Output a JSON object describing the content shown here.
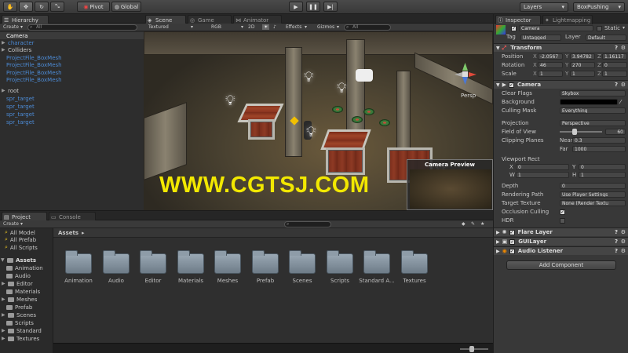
{
  "toolbar": {
    "pivot_label": "Pivot",
    "global_label": "Global",
    "layers_label": "Layers",
    "layout_label": "BoxPushing"
  },
  "hierarchy": {
    "tab_label": "Hierarchy",
    "create_label": "Create",
    "search_placeholder": "All",
    "items": [
      {
        "label": "Camera",
        "selected": true,
        "blue": false
      },
      {
        "label": "character",
        "blue": true,
        "arrow": true
      },
      {
        "label": "Colliders",
        "blue": false,
        "arrow": true
      },
      {
        "label": "ProjectFile_BoxMesh",
        "blue": true
      },
      {
        "label": "ProjectFile_BoxMesh",
        "blue": true
      },
      {
        "label": "ProjectFile_BoxMesh",
        "blue": true
      },
      {
        "label": "ProjectFile_BoxMesh",
        "blue": true
      },
      {
        "label": "root",
        "blue": false,
        "arrow": true
      },
      {
        "label": "spr_target",
        "blue": true
      },
      {
        "label": "spr_target",
        "blue": true
      },
      {
        "label": "spr_target",
        "blue": true
      },
      {
        "label": "spr_target",
        "blue": true
      }
    ]
  },
  "scene": {
    "tabs": [
      "Scene",
      "Game",
      "Animator"
    ],
    "shading": "Textured",
    "render_mode": "RGB",
    "mode_2d": "2D",
    "effects_label": "Effects",
    "gizmos_label": "Gizmos",
    "search_placeholder": "All",
    "persp_label": "Persp",
    "watermark": "WWW.CGTSJ.COM",
    "camera_preview_title": "Camera Preview"
  },
  "inspector": {
    "tabs": [
      "Inspector",
      "Lightmapping"
    ],
    "object_name": "Camera",
    "static_label": "Static",
    "tag_label": "Tag",
    "tag_value": "Untagged",
    "layer_label": "Layer",
    "layer_value": "Default",
    "transform": {
      "title": "Transform",
      "position_label": "Position",
      "position": {
        "x": "-2.0567",
        "y": "3.94782",
        "z": "1.16117"
      },
      "rotation_label": "Rotation",
      "rotation": {
        "x": "46",
        "y": "270",
        "z": "0"
      },
      "scale_label": "Scale",
      "scale": {
        "x": "1",
        "y": "1",
        "z": "1"
      }
    },
    "camera": {
      "title": "Camera",
      "clear_flags_label": "Clear Flags",
      "clear_flags_value": "Skybox",
      "background_label": "Background",
      "culling_mask_label": "Culling Mask",
      "culling_mask_value": "Everything",
      "projection_label": "Projection",
      "projection_value": "Perspective",
      "fov_label": "Field of View",
      "fov_value": "60",
      "fov_fraction": 0.33,
      "clipping_label": "Clipping Planes",
      "near_label": "Near",
      "near_value": "0.3",
      "far_label": "Far",
      "far_value": "1000",
      "viewport_label": "Viewport Rect",
      "vx_label": "X",
      "vx_value": "0",
      "vy_label": "Y",
      "vy_value": "0",
      "vw_label": "W",
      "vw_value": "1",
      "vh_label": "H",
      "vh_value": "1",
      "depth_label": "Depth",
      "depth_value": "0",
      "rendering_path_label": "Rendering Path",
      "rendering_path_value": "Use Player Settings",
      "target_texture_label": "Target Texture",
      "target_texture_value": "None (Render Textu",
      "occlusion_label": "Occlusion Culling",
      "hdr_label": "HDR"
    },
    "components": [
      "Flare Layer",
      "GUILayer",
      "Audio Listener"
    ],
    "add_component_label": "Add Component"
  },
  "project": {
    "tabs": [
      "Project",
      "Console"
    ],
    "create_label": "Create",
    "favorites": [
      "All Model",
      "All Prefab",
      "All Scripts"
    ],
    "assets_root": "Assets",
    "tree_folders": [
      "Animation",
      "Audio",
      "Editor",
      "Materials",
      "Meshes",
      "Prefab",
      "Scenes",
      "Scripts",
      "Standard",
      "Textures"
    ],
    "breadcrumb": "Assets",
    "folders": [
      "Animation",
      "Audio",
      "Editor",
      "Materials",
      "Meshes",
      "Prefab",
      "Scenes",
      "Scripts",
      "Standard A...",
      "Textures"
    ]
  }
}
